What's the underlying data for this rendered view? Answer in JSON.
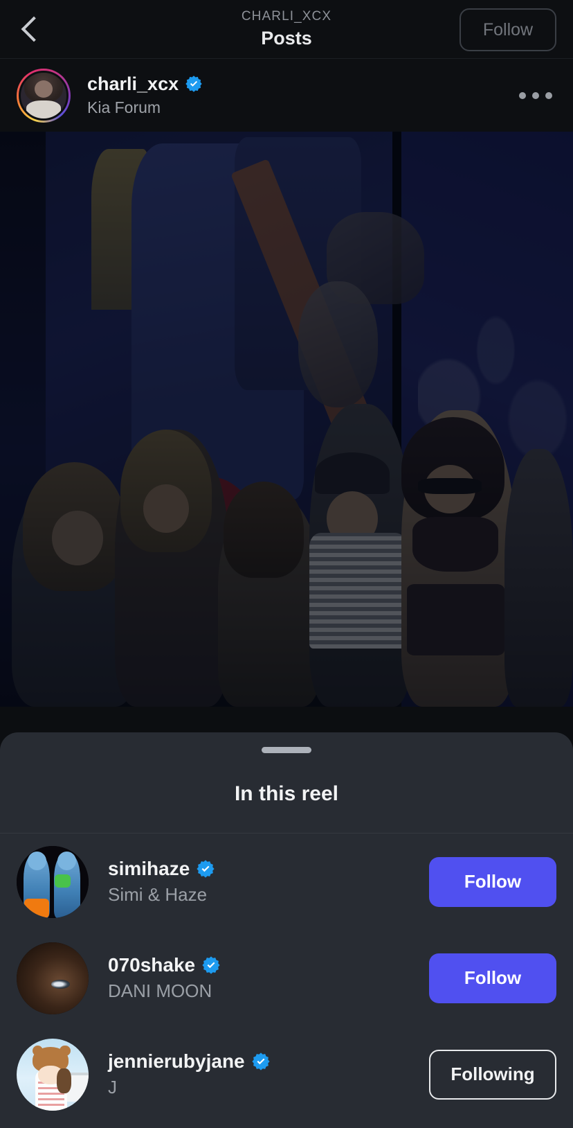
{
  "navbar": {
    "back_icon": "chevron-left-icon",
    "eyebrow": "CHARLI_XCX",
    "title": "Posts",
    "follow_label": "Follow"
  },
  "post_header": {
    "username": "charli_xcx",
    "verified": true,
    "location": "Kia Forum",
    "more_icon": "more-options-icon",
    "avatar_ring": "story-gradient-ring"
  },
  "media": {
    "type": "reel-video",
    "description": "Concert crowd at Kia Forum with stage screen and guitarist"
  },
  "sheet": {
    "handle": "drag-handle",
    "title": "In this reel",
    "rows": [
      {
        "username": "simihaze",
        "verified": true,
        "fullname": "Simi & Haze",
        "button_label": "Follow",
        "button_state": "follow"
      },
      {
        "username": "070shake",
        "verified": true,
        "fullname": "DANI MOON",
        "button_label": "Follow",
        "button_state": "follow"
      },
      {
        "username": "jennierubyjane",
        "verified": true,
        "fullname": "J",
        "button_label": "Following",
        "button_state": "following"
      }
    ]
  },
  "colors": {
    "follow_button": "#5050f0",
    "verified_badge": "#1d9bf0",
    "sheet_background": "#282c33",
    "page_background": "#0d0f12",
    "handle": "#adb2ba"
  }
}
